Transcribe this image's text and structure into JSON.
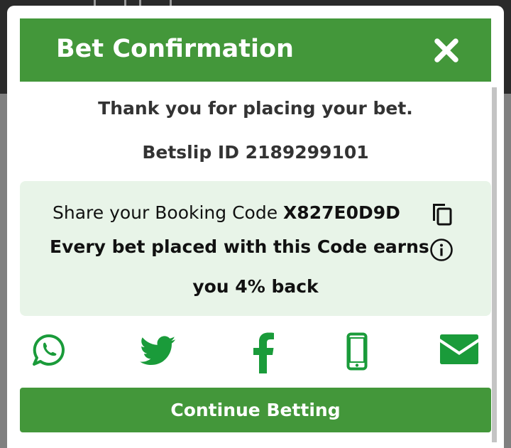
{
  "modal": {
    "title": "Bet Confirmation",
    "close_icon": "close-icon",
    "thank_you": "Thank you for placing your bet.",
    "betslip_id": "Betslip ID 2189299101"
  },
  "booking": {
    "share_prefix": "Share your Booking Code ",
    "code": "X827E0D9D",
    "earn_line1": "Every bet placed with this Code earns",
    "earn_line2": "you 4% back",
    "copy_icon": "copy-icon",
    "info_icon": "info-icon"
  },
  "share_icons": [
    "whatsapp-icon",
    "twitter-icon",
    "facebook-icon",
    "mobile-phone-icon",
    "email-icon"
  ],
  "actions": {
    "continue_label": "Continue Betting"
  },
  "colors": {
    "brand_green": "#43973a",
    "icon_green": "#1a9b3a",
    "booking_bg": "#e8f4e8",
    "text_dark": "#333333"
  }
}
